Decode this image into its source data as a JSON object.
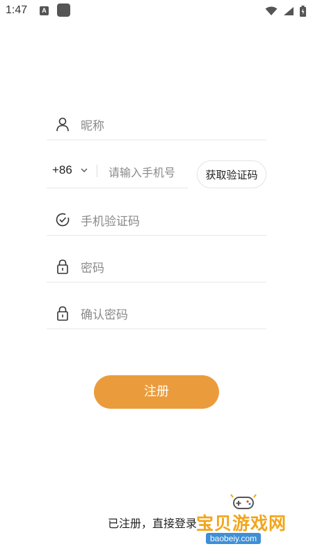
{
  "status_bar": {
    "time": "1:47",
    "notification_letter": "A"
  },
  "form": {
    "nickname_placeholder": "昵称",
    "country_code": "+86",
    "phone_placeholder": "请输入手机号",
    "get_code_label": "获取验证码",
    "sms_code_placeholder": "手机验证码",
    "password_placeholder": "密码",
    "confirm_password_placeholder": "确认密码",
    "register_label": "注册"
  },
  "footer": {
    "login_prompt": "已注册，直接登录"
  },
  "watermark": {
    "title": "宝贝游戏网",
    "url": "baobeiy.com"
  },
  "colors": {
    "accent": "#ea9c3d",
    "placeholder": "#8a8a8a",
    "divider": "#e8e8e8"
  },
  "icons": [
    "user-icon",
    "chevron-down-icon",
    "check-circle-icon",
    "lock-icon",
    "wifi-icon",
    "signal-icon",
    "battery-icon"
  ]
}
